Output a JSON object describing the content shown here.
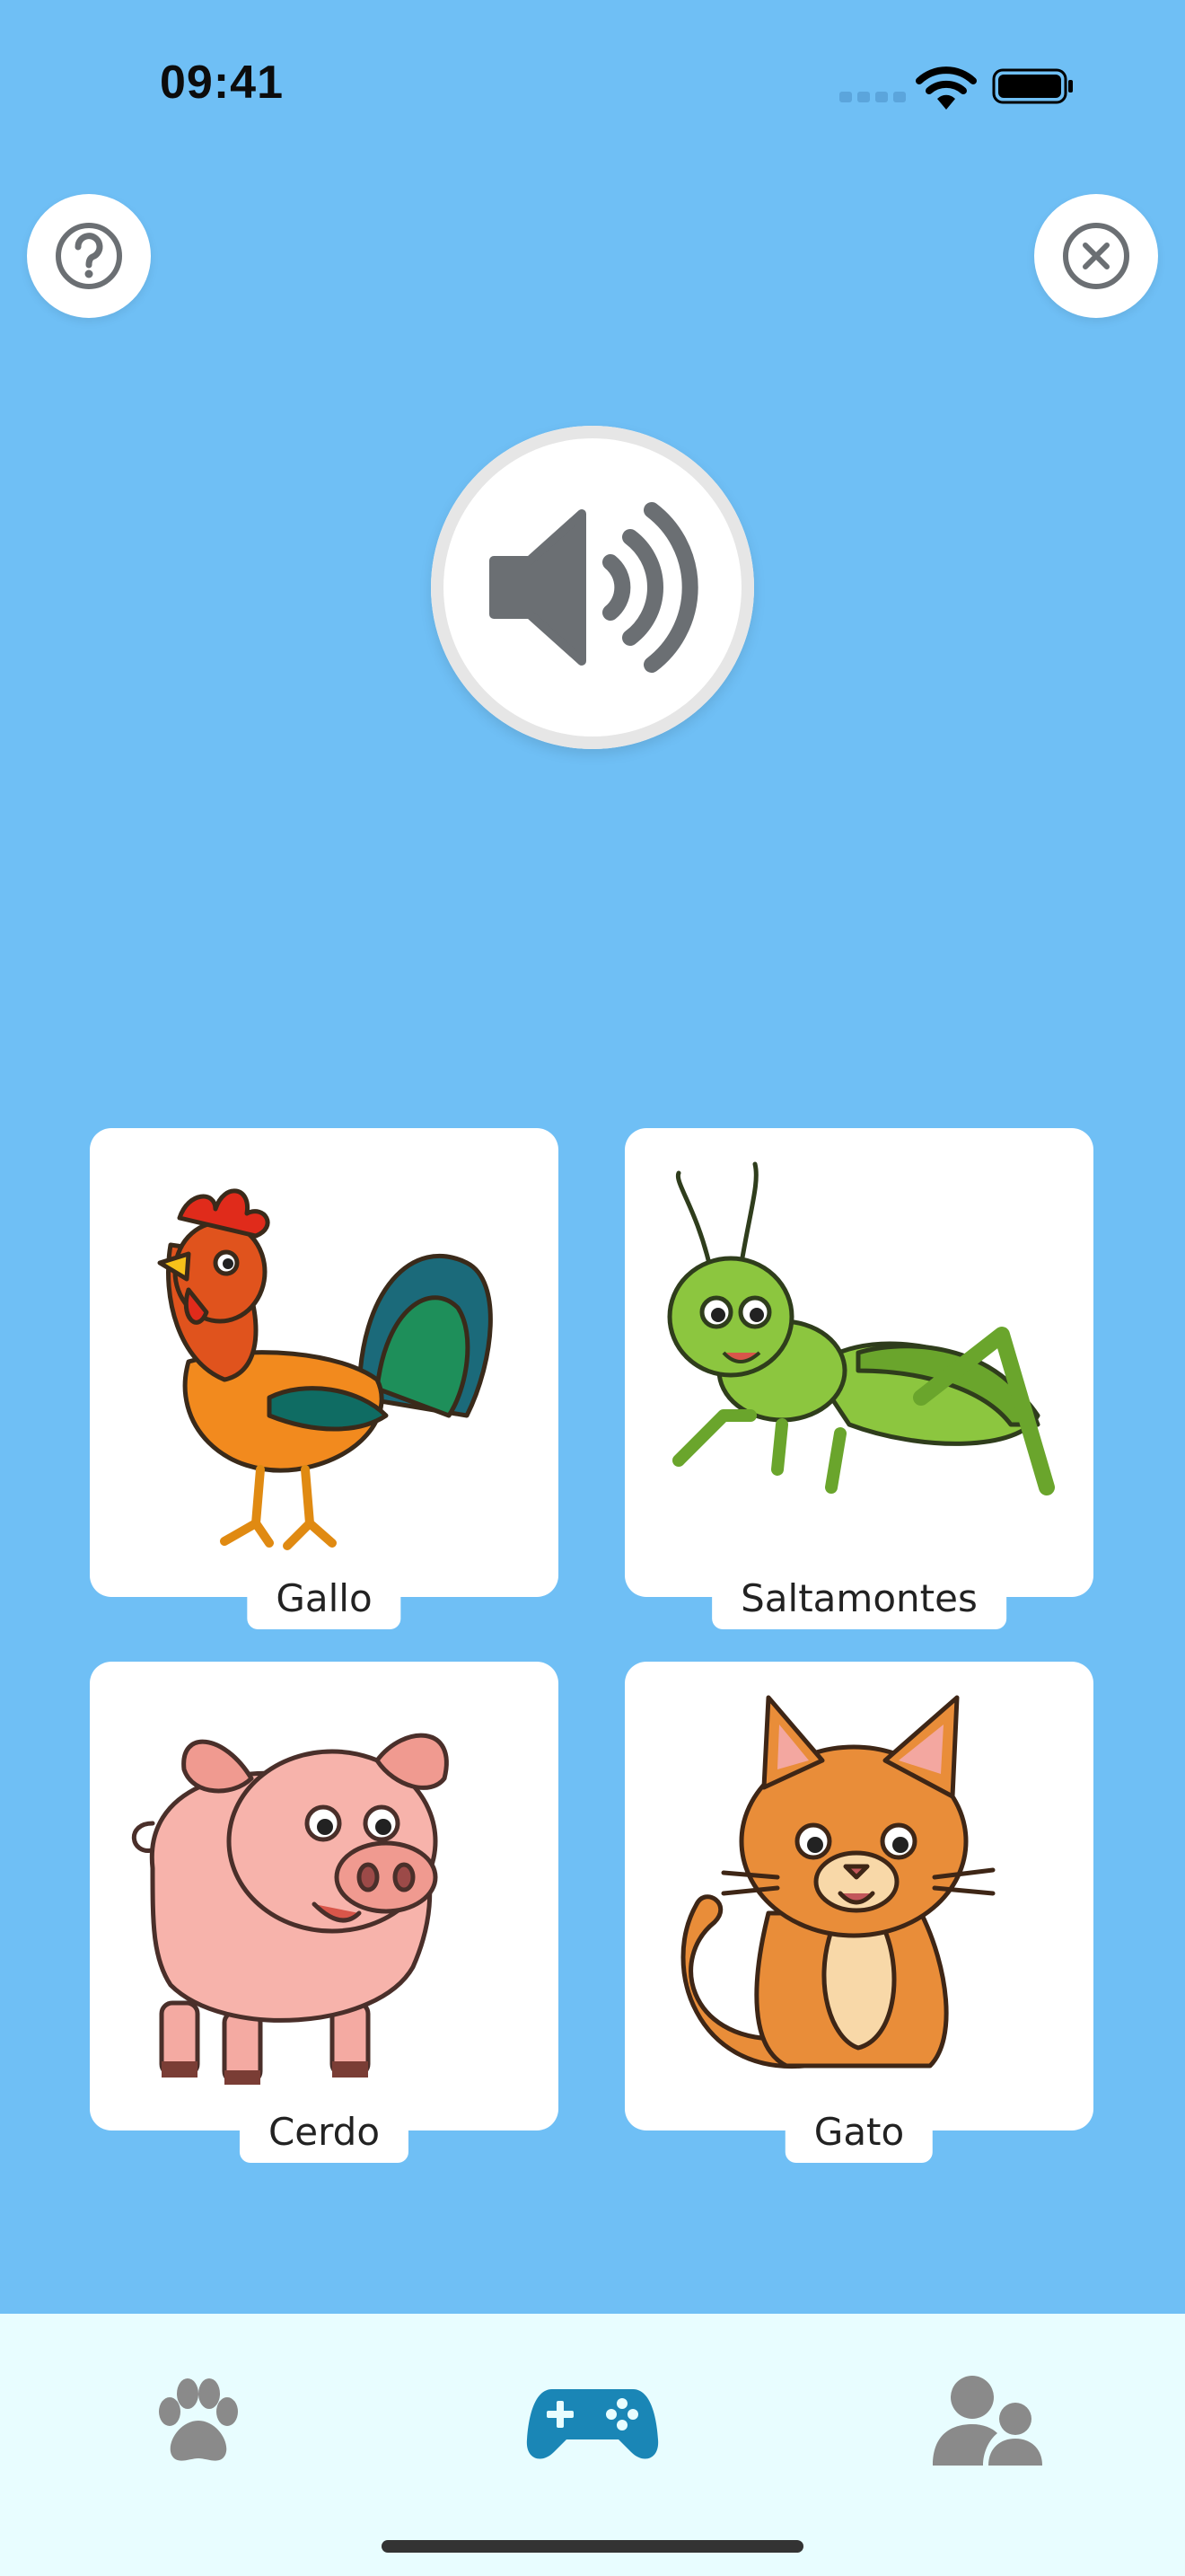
{
  "status_bar": {
    "time": "09:41"
  },
  "header": {
    "help_icon": "question-circle-icon",
    "close_icon": "close-circle-icon"
  },
  "sound_button": {
    "icon": "speaker-volume-icon"
  },
  "cards": [
    {
      "label": "Gallo",
      "icon": "rooster-illustration"
    },
    {
      "label": "Saltamontes",
      "icon": "grasshopper-illustration"
    },
    {
      "label": "Cerdo",
      "icon": "pig-illustration"
    },
    {
      "label": "Gato",
      "icon": "cat-illustration"
    }
  ],
  "tabbar": {
    "tabs": [
      {
        "icon": "paw-icon",
        "active": false
      },
      {
        "icon": "gamepad-icon",
        "active": true
      },
      {
        "icon": "users-icon",
        "active": false
      }
    ],
    "colors": {
      "active": "#1a86b6",
      "inactive": "#8a8a8a"
    }
  },
  "colors": {
    "background": "#6fbff5",
    "tabbar": "#e8fdff",
    "sound_icon": "#6b6f73"
  }
}
